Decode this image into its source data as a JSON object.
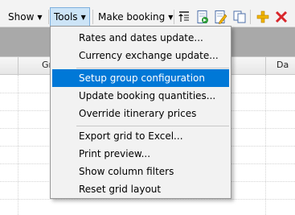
{
  "toolbar": {
    "show_label": "Show",
    "tools_label": "Tools",
    "make_booking_label": "Make booking",
    "icons": [
      "sort-icon",
      "export-icon",
      "edit-icon",
      "copy-icon",
      "add-icon",
      "delete-icon"
    ]
  },
  "grid": {
    "columns": [
      "Gr",
      "Da"
    ]
  },
  "tools_menu": {
    "groups": [
      [
        "Rates and dates update...",
        "Currency exchange update..."
      ],
      [
        "Setup group configuration",
        "Update booking quantities...",
        "Override itinerary prices"
      ],
      [
        "Export grid to Excel...",
        "Print preview...",
        "Show column filters",
        "Reset grid layout"
      ]
    ],
    "selected": "Setup group configuration"
  },
  "colors": {
    "selection": "#0078d7",
    "active_button": "#cce4f7",
    "add_icon": "#f0b400",
    "delete_icon": "#d9262b"
  }
}
